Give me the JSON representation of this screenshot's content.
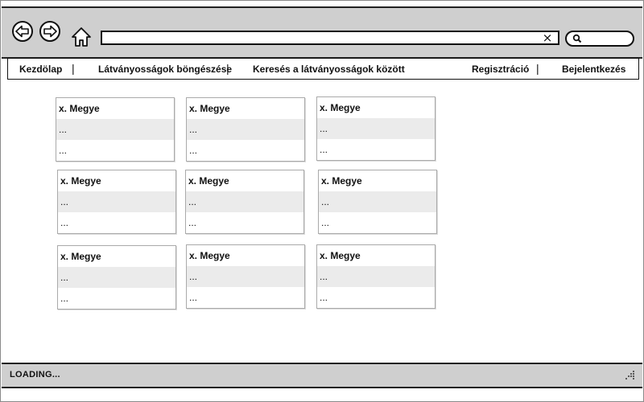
{
  "toolbar": {
    "url_value": "",
    "url_clear_glyph": "⨯",
    "search_placeholder": ""
  },
  "nav": {
    "items": [
      "Kezdölap",
      "Látványosságok böngészése",
      "Keresés a látványosságok között",
      "Regisztráció",
      "Bejelentkezés"
    ],
    "separator": "|"
  },
  "cards": [
    {
      "title": "x. Megye",
      "rows": [
        "...",
        "..."
      ]
    },
    {
      "title": "x. Megye",
      "rows": [
        "...",
        "..."
      ]
    },
    {
      "title": "x. Megye",
      "rows": [
        "...",
        "..."
      ]
    },
    {
      "title": "x. Megye",
      "rows": [
        "...",
        "..."
      ]
    },
    {
      "title": "x. Megye",
      "rows": [
        "...",
        "..."
      ]
    },
    {
      "title": "x. Megye",
      "rows": [
        "...",
        "..."
      ]
    },
    {
      "title": "x. Megye",
      "rows": [
        "...",
        "..."
      ]
    },
    {
      "title": "x. Megye",
      "rows": [
        "...",
        "..."
      ]
    },
    {
      "title": "x. Megye",
      "rows": [
        "...",
        "..."
      ]
    }
  ],
  "status": {
    "text": "LOADING..."
  },
  "icons": {
    "back": "back-arrow-icon",
    "forward": "forward-arrow-icon",
    "home": "home-icon",
    "search": "search-icon",
    "resize": "resize-grip-icon"
  },
  "colors": {
    "chrome": "#cfcfcf",
    "border": "#111111",
    "row_alt": "#ebebeb"
  }
}
